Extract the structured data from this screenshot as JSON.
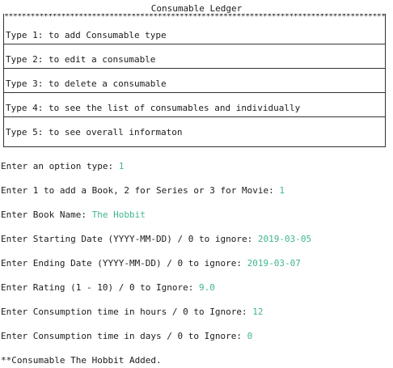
{
  "window": {
    "title": "Consumable Ledger"
  },
  "menu": {
    "border": "***************************************************************************************",
    "items": [
      {
        "label": "Type 1: to add Consumable type"
      },
      {
        "label": "Type 2: to edit a consumable"
      },
      {
        "label": "Type 3: to delete a consumable"
      },
      {
        "label": "Type 4: to see the list of consumables and individually"
      },
      {
        "label": "Type 5: to see overall informaton"
      }
    ]
  },
  "session": {
    "prompts": [
      {
        "prompt": "Enter an option type: ",
        "value": "1"
      },
      {
        "prompt": "Enter 1 to add a Book, 2 for Series or 3 for Movie: ",
        "value": "1"
      },
      {
        "prompt": "Enter Book Name: ",
        "value": "The Hobbit"
      },
      {
        "prompt": "Enter Starting Date (YYYY-MM-DD) / 0 to ignore: ",
        "value": "2019-03-05"
      },
      {
        "prompt": "Enter Ending Date (YYYY-MM-DD) / 0 to ignore: ",
        "value": "2019-03-07"
      },
      {
        "prompt": "Enter Rating (1 - 10) / 0 to Ignore: ",
        "value": "9.0"
      },
      {
        "prompt": "Enter Consumption time in hours / 0 to Ignore: ",
        "value": "12"
      },
      {
        "prompt": "Enter Consumption time in days / 0 to Ignore: ",
        "value": "0"
      }
    ],
    "result": "**Consumable The Hobbit Added."
  },
  "colors": {
    "text": "#1b1b1b",
    "input_value": "#3fb68b",
    "background": "#ffffff"
  }
}
